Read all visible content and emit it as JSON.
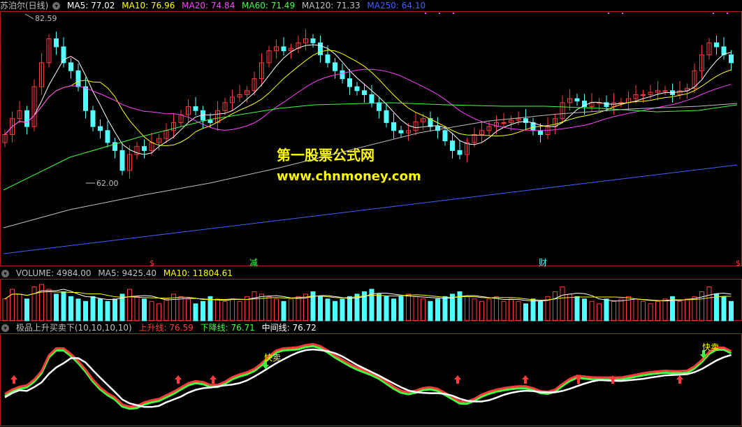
{
  "header": {
    "stock_name": "苏泊尔(日线)",
    "ma": [
      {
        "label": "MA5: 77.02",
        "color": "#ffffff"
      },
      {
        "label": "MA10: 76.96",
        "color": "#ffff00"
      },
      {
        "label": "MA20: 74.84",
        "color": "#ff40ff"
      },
      {
        "label": "MA60: 71.49",
        "color": "#40ff40"
      },
      {
        "label": "MA120: 71.33",
        "color": "#c0c0c0"
      },
      {
        "label": "MA250: 64.10",
        "color": "#4060ff"
      }
    ]
  },
  "price_panel": {
    "high_marker": "82.59",
    "low_marker": "62.00",
    "events": [
      "减",
      "财"
    ]
  },
  "volume_panel": {
    "title": "VOLUME: 4984.00",
    "ma5": "MA5: 9425.40",
    "ma10": "MA10: 11804.61"
  },
  "indicator_panel": {
    "name": "极品上升买卖下(10,10,10,10)",
    "up": "上升线: 76.59",
    "down": "下降线: 76.71",
    "mid": "中间线: 76.72",
    "sell_label": "快卖"
  },
  "watermark": {
    "line1": "第一股票公式网",
    "line2": "www.chnmoney.com"
  },
  "colors": {
    "up": "#ff3b3b",
    "down": "#54ffff",
    "frame": "#aa1e1e",
    "ma5": "#ffffff",
    "ma10": "#ffff00",
    "ma20": "#ff40ff",
    "ma60": "#40ff40",
    "ma120": "#c0c0c0",
    "ma250": "#4060ff"
  },
  "chart_data": {
    "type": "candlestick",
    "close": [
      68,
      70,
      71,
      69,
      74,
      77,
      80,
      79,
      77,
      76,
      74,
      71,
      69,
      68.5,
      67,
      66,
      63.5,
      65.5,
      66.5,
      66,
      67,
      67.5,
      68.5,
      69.5,
      70.5,
      71.5,
      71,
      69.8,
      69.5,
      71,
      72,
      72.7,
      73,
      73.5,
      75,
      77,
      78.5,
      79,
      78.5,
      78.8,
      79.5,
      80,
      79.5,
      78,
      77,
      76,
      75,
      74,
      73.5,
      73,
      72,
      71,
      69.5,
      68.5,
      68.2,
      68.5,
      69.6,
      70,
      69,
      68.5,
      67.2,
      66,
      65.5,
      67,
      68,
      68.5,
      69,
      69.5,
      69.5,
      69.8,
      70,
      69.5,
      68.5,
      68,
      69,
      70,
      72,
      72.5,
      72.2,
      71.5,
      72,
      72,
      71.5,
      72,
      72,
      72.5,
      73,
      73,
      73.3,
      73.5,
      73.5,
      73,
      73.5,
      73.8,
      76,
      78,
      79.5,
      79,
      78,
      77
    ],
    "ma_lines": [
      "MA5",
      "MA10",
      "MA20",
      "MA60",
      "MA120",
      "MA250"
    ],
    "volume": [
      9,
      13,
      11,
      9,
      14,
      15,
      13,
      11,
      12,
      10,
      9,
      8,
      10,
      9,
      8,
      9,
      11,
      13,
      10,
      9,
      8,
      7,
      9,
      11,
      10,
      9,
      7,
      8,
      10,
      9,
      8,
      9,
      8,
      10,
      12,
      11,
      10,
      9,
      8,
      9,
      10,
      11,
      12,
      10,
      9,
      8,
      9,
      10,
      11,
      12,
      13,
      11,
      10,
      9,
      10,
      11,
      10,
      9,
      8,
      9,
      10,
      11,
      12,
      10,
      9,
      8,
      9,
      10,
      8,
      9,
      8,
      7,
      9,
      8,
      10,
      12,
      14,
      11,
      10,
      9,
      8,
      7,
      9,
      8,
      9,
      10,
      9,
      8,
      7,
      8,
      9,
      10,
      8,
      9,
      10,
      12,
      14,
      11,
      10,
      8
    ]
  }
}
